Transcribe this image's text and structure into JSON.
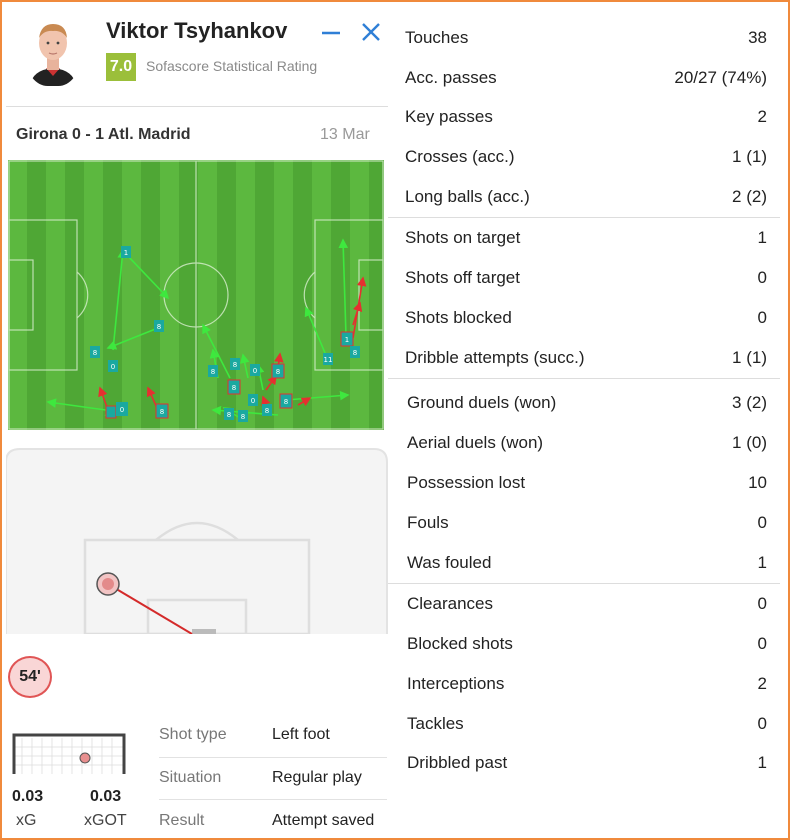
{
  "player": {
    "name": "Viktor Tsyhankov",
    "rating": "7.0",
    "rating_label": "Sofascore Statistical Rating"
  },
  "match": {
    "teams": "Girona 0 - 1 Atl. Madrid",
    "date": "13 Mar"
  },
  "shot": {
    "minute": "54'",
    "xg": "0.03",
    "xg_label": "xG",
    "xgot": "0.03",
    "xgot_label": "xGOT",
    "details": [
      {
        "key": "Shot type",
        "value": "Left foot"
      },
      {
        "key": "Situation",
        "value": "Regular play"
      },
      {
        "key": "Result",
        "value": "Attempt saved"
      }
    ]
  },
  "stats": {
    "attacking": [
      {
        "label": "Touches",
        "value": "38"
      },
      {
        "label": "Acc. passes",
        "value": "20/27 (74%)"
      },
      {
        "label": "Key passes",
        "value": "2"
      },
      {
        "label": "Crosses (acc.)",
        "value": "1 (1)"
      },
      {
        "label": "Long balls (acc.)",
        "value": "2 (2)"
      }
    ],
    "shooting": [
      {
        "label": "Shots on target",
        "value": "1"
      },
      {
        "label": "Shots off target",
        "value": "0"
      },
      {
        "label": "Shots blocked",
        "value": "0"
      },
      {
        "label": "Dribble attempts (succ.)",
        "value": "1 (1)"
      }
    ],
    "duels": [
      {
        "label": "Ground duels (won)",
        "value": "3 (2)"
      },
      {
        "label": "Aerial duels (won)",
        "value": "1 (0)"
      },
      {
        "label": "Possession lost",
        "value": "10"
      },
      {
        "label": "Fouls",
        "value": "0"
      },
      {
        "label": "Was fouled",
        "value": "1"
      }
    ],
    "defending": [
      {
        "label": "Clearances",
        "value": "0"
      },
      {
        "label": "Blocked shots",
        "value": "0"
      },
      {
        "label": "Interceptions",
        "value": "2"
      },
      {
        "label": "Tackles",
        "value": "0"
      },
      {
        "label": "Dribbled past",
        "value": "1"
      }
    ]
  },
  "colors": {
    "accent_frame": "#f08a3c",
    "rating_green": "#9bbf3a",
    "pitch_green": "#5cae3c",
    "pass_success": "#3ee83e",
    "pass_fail": "#e53030",
    "marker_teal": "#1aa9a0"
  },
  "icons": {
    "minimize": "minimize-icon",
    "close": "close-icon"
  }
}
